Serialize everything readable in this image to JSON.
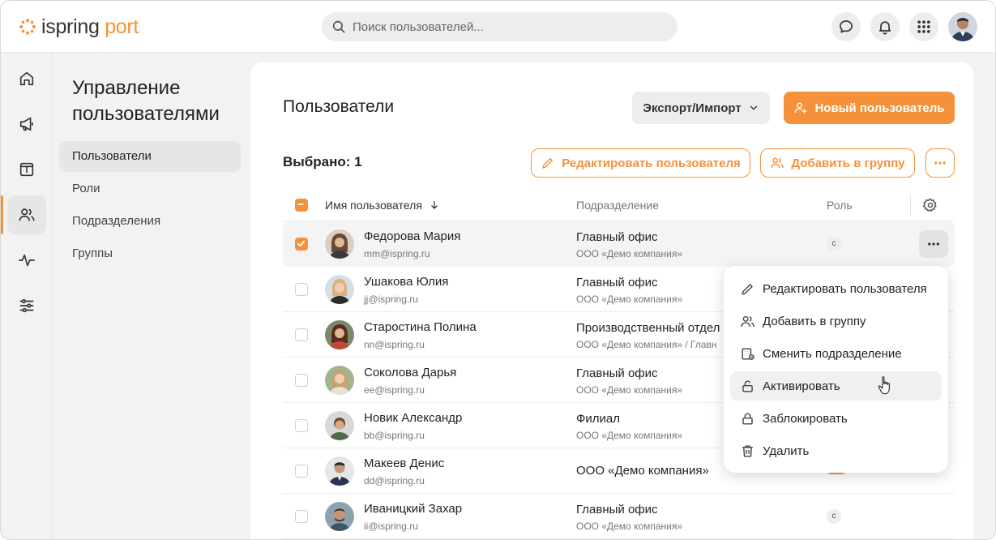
{
  "app": {
    "logo_main": "ispring",
    "logo_accent": " port"
  },
  "search": {
    "placeholder": "Поиск пользователей..."
  },
  "header_icons": [
    "chat-icon",
    "bell-icon",
    "apps-grid-icon",
    "user-avatar"
  ],
  "rail": [
    "home-icon",
    "megaphone-icon",
    "info-board-icon",
    "users-icon",
    "activity-icon",
    "sliders-icon"
  ],
  "subnav": {
    "title": "Управление пользователями",
    "items": [
      "Пользователи",
      "Роли",
      "Подразделения",
      "Группы"
    ],
    "active_index": 0
  },
  "main": {
    "title": "Пользователи",
    "export_label": "Экспорт/Импорт",
    "new_user_label": "Новый пользователь",
    "selected_label": "Выбрано: 1",
    "edit_user_label": "Редактировать пользователя",
    "add_group_label": "Добавить в группу"
  },
  "table": {
    "columns": {
      "name": "Имя пользователя",
      "dept": "Подразделение",
      "role": "Роль"
    },
    "rows": [
      {
        "name": "Федорова Мария",
        "email": "mm@ispring.ru",
        "dept": "Главный офис",
        "company": "ООО «Демо компания»",
        "role": "с",
        "selected": true
      },
      {
        "name": "Ушакова Юлия",
        "email": "jj@ispring.ru",
        "dept": "Главный офис",
        "company": "ООО «Демо компания»",
        "role": "",
        "selected": false
      },
      {
        "name": "Старостина Полина",
        "email": "nn@ispring.ru",
        "dept": "Производственный отдел",
        "company": "ООО «Демо компания» / Главн",
        "role": "",
        "selected": false
      },
      {
        "name": "Соколова Дарья",
        "email": "ee@ispring.ru",
        "dept": "Главный офис",
        "company": "ООО «Демо компания»",
        "role": "",
        "selected": false
      },
      {
        "name": "Новик Александр",
        "email": "bb@ispring.ru",
        "dept": "Филиал",
        "company": "ООО «Демо компания»",
        "role": "",
        "selected": false
      },
      {
        "name": "Макеев Денис",
        "email": "dd@ispring.ru",
        "dept": "ООО «Демо компания»",
        "company": "",
        "role": "",
        "selected": false
      },
      {
        "name": "Иваницкий Захар",
        "email": "ii@ispring.ru",
        "dept": "Главный офис",
        "company": "ООО «Демо компания»",
        "role": "с",
        "selected": false
      }
    ]
  },
  "context_menu": {
    "items": [
      {
        "label": "Редактировать пользователя",
        "icon": "pencil-icon"
      },
      {
        "label": "Добавить в группу",
        "icon": "users-icon"
      },
      {
        "label": "Сменить подразделение",
        "icon": "building-icon"
      },
      {
        "label": "Активировать",
        "icon": "unlock-icon"
      },
      {
        "label": "Заблокировать",
        "icon": "lock-icon"
      },
      {
        "label": "Удалить",
        "icon": "trash-icon"
      }
    ],
    "hover_index": 3
  },
  "colors": {
    "accent": "#f5913a",
    "bg": "#f2f2f2",
    "text": "#222222"
  }
}
